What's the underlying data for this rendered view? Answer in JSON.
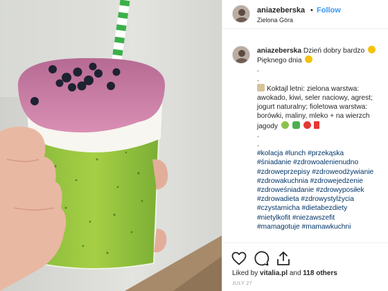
{
  "post": {
    "username": "aniazeberska",
    "separator": "•",
    "follow_label": "Follow",
    "location": "Zielona Góra"
  },
  "caption": {
    "username": "aniazeberska",
    "lines": [
      "Dzień dobry bardzo",
      "Pięknego dnia",
      ".",
      ".",
      "Koktajl letni: zielona warstwa:",
      "awokado, kiwi, seler naciowy, agrest;",
      "jogurt naturalny; fioletowa warstwa:",
      "borówki, maliny, mleko + na wierzch",
      "jagody",
      ".",
      "."
    ],
    "hashtag_lines": [
      "#kolacja #lunch #przekąska",
      "#śniadanie #zdrowoalenienudno",
      "#zdrowepr​zepisy #zdroweodżywianie",
      "#zdrowakuchnia #zdrowejedzenie",
      "#zdroweśniadanie #zdrowyposiłek",
      "#zdrowadieta #zdrowystylżycia",
      "#czystamicha #dietabezdiety",
      "#nietylkofit #niezawszefit",
      "#mamagotuje #mamawkuchni"
    ]
  },
  "actions": {
    "icons": [
      "heart-icon",
      "comment-icon",
      "share-icon"
    ]
  },
  "likes": {
    "prefix": "Liked by",
    "user": "vitalia.pl",
    "middle": "and",
    "count_text": "118 others"
  },
  "date": "JULY 27",
  "colors": {
    "follow": "#3897f0",
    "hashtag": "#003569",
    "text": "#262626",
    "muted": "#999999"
  }
}
